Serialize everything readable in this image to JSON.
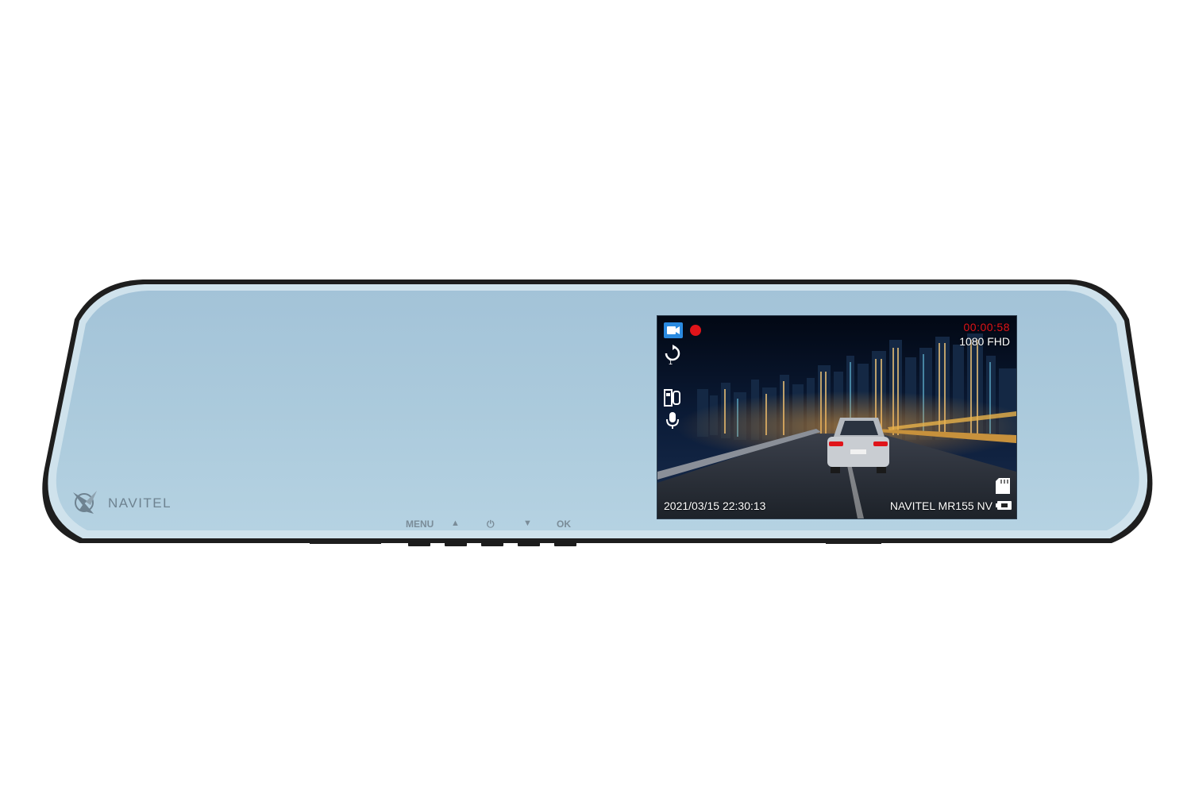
{
  "device": {
    "brand": "NAVITEL",
    "buttons": {
      "menu_label": "MENU",
      "up_label": "▲",
      "power_label": "⏻",
      "down_label": "▼",
      "ok_label": "OK"
    }
  },
  "screen": {
    "rec_time": "00:00:58",
    "resolution": "1080 FHD",
    "datetime": "2021/03/15  22:30:13",
    "model": "NAVITEL MR155 NV",
    "icons": [
      "video-mode-icon",
      "record-indicator-icon",
      "loop-recording-icon",
      "dual-camera-icon",
      "microphone-icon",
      "sd-card-icon",
      "battery-icon"
    ]
  },
  "colors": {
    "mirror_fill": "#a9c9dc",
    "rim": "#c9dde8",
    "frame": "#1e1e1e",
    "record_red": "#e0141a"
  }
}
